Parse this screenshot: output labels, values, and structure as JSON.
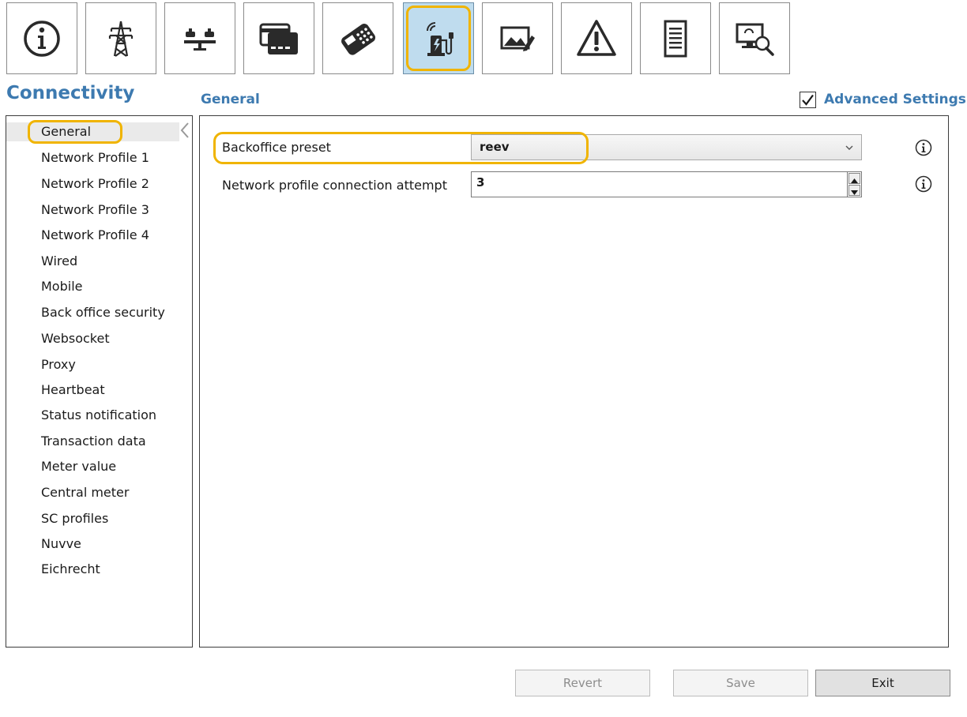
{
  "toolbar": {
    "buttons": [
      {
        "icon": "info-icon"
      },
      {
        "icon": "power-pylon-icon"
      },
      {
        "icon": "scale-balance-icon"
      },
      {
        "icon": "payment-card-icon"
      },
      {
        "icon": "card-terminal-icon"
      },
      {
        "icon": "ev-charger-connectivity-icon",
        "selected": true
      },
      {
        "icon": "image-edit-icon"
      },
      {
        "icon": "warning-icon"
      },
      {
        "icon": "document-icon"
      },
      {
        "icon": "diagnostics-monitor-icon"
      }
    ]
  },
  "section_title": "Connectivity",
  "sub_title": "General",
  "advanced_settings": {
    "label": "Advanced Settings",
    "checked": true
  },
  "sidebar": {
    "items": [
      "General",
      "Network Profile 1",
      "Network Profile 2",
      "Network Profile 3",
      "Network Profile 4",
      "Wired",
      "Mobile",
      "Back office security",
      "Websocket",
      "Proxy",
      "Heartbeat",
      "Status notification",
      "Transaction data",
      "Meter value",
      "Central meter",
      "SC profiles",
      "Nuvve",
      "Eichrecht"
    ],
    "selected": "General"
  },
  "settings": {
    "backoffice_preset": {
      "label": "Backoffice preset",
      "value": "reev"
    },
    "connection_attempt": {
      "label": "Network profile connection attempt",
      "value": "3"
    }
  },
  "buttons": {
    "revert": "Revert",
    "save": "Save",
    "exit": "Exit"
  },
  "colors": {
    "accent": "#3d7ab0",
    "highlight": "#f0b400",
    "selected_tab": "#bfdcee"
  }
}
